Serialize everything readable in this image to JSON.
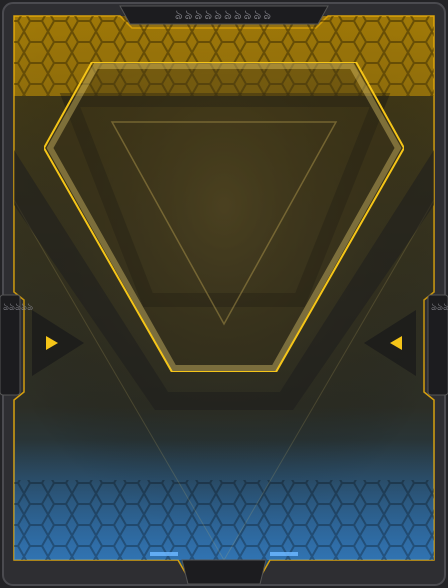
{
  "card": {
    "top_glyphs": "ঌঌঌঌঌঌঌঌঌঌ",
    "left_glyphs": "ঌঌঌঌঌ",
    "right_glyphs": "ঌঌঌঌঌ"
  },
  "theme": {
    "frame_color": "#2b2b2e",
    "frame_edge": "#4a4a4e",
    "glow_gold": "#f5c518",
    "panel_top": "#3b3418",
    "panel_mid": "#2c2a20",
    "panel_bottom": "#1f4a6e",
    "hex_gold": "#e0a800",
    "hex_blue": "#3c7cc0"
  },
  "icons": {
    "left_arrow": "triangle-left-icon",
    "right_arrow": "triangle-right-icon",
    "emblem": "inverted-triangle-emblem"
  }
}
